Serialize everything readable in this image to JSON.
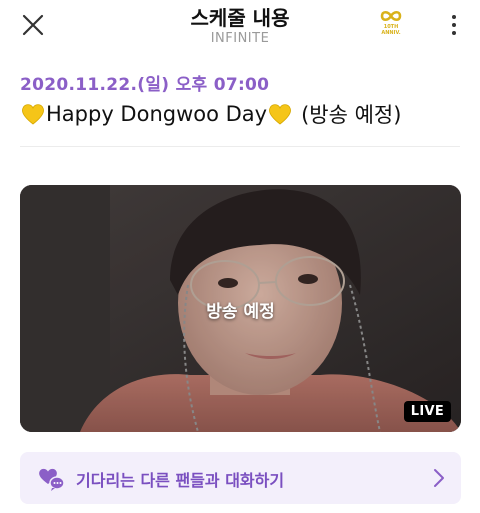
{
  "header": {
    "title": "스케줄 내용",
    "subtitle": "INFINITE",
    "anniv_badge": "10TH ANNIV.",
    "icons": [
      "close-icon",
      "infinity-anniversary-icon",
      "more-vertical-icon"
    ]
  },
  "schedule": {
    "date": "2020.11.22.(일) 오후 07:00",
    "title_text": "Happy Dongwoo Day",
    "title_suffix": "(방송 예정)",
    "heart_color": "#f5c518"
  },
  "video": {
    "status": "방송 예정",
    "live_label": "LIVE"
  },
  "chat": {
    "label": "기다리는 다른 팬들과 대화하기",
    "icon": "heart-chat-icon",
    "accent": "#8b5fc7"
  },
  "colors": {
    "accent": "#8b5fc7",
    "chat_bg": "#f3effb",
    "gold": "#d9b21b"
  }
}
